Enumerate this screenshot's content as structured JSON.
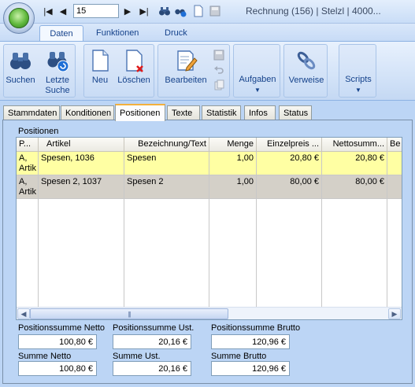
{
  "toolbar": {
    "record_number": "15",
    "window_title": "Rechnung    (156) | Stelzl | 4000..."
  },
  "ribbon_tabs": [
    {
      "label": "Daten",
      "active": true
    },
    {
      "label": "Funktionen",
      "active": false
    },
    {
      "label": "Druck",
      "active": false
    }
  ],
  "ribbon_buttons": {
    "suchen": "Suchen",
    "letzte_suche": "Letzte\nSuche",
    "neu": "Neu",
    "loeschen": "Löschen",
    "bearbeiten": "Bearbeiten",
    "aufgaben": "Aufgaben",
    "verweise": "Verweise",
    "scripts": "Scripts"
  },
  "doc_tabs": [
    {
      "label": "Stammdaten",
      "active": false
    },
    {
      "label": "Konditionen",
      "active": false
    },
    {
      "label": "Positionen",
      "active": true
    },
    {
      "label": "Texte",
      "active": false
    },
    {
      "label": "Statistik",
      "active": false
    },
    {
      "label": "Infos",
      "active": false
    },
    {
      "label": "Status",
      "active": false
    }
  ],
  "positions": {
    "section_label": "Positionen",
    "columns": [
      "P...",
      "Artikel",
      "Bezeichnung/Text",
      "Menge",
      "Einzelpreis ...",
      "Nettosumm...",
      "Be"
    ],
    "rows": [
      {
        "p": "A, Artik",
        "artikel": "Spesen, 1036",
        "bezeichnung": "Spesen",
        "menge": "1,00",
        "einzelpreis": "20,80 €",
        "nettosumme": "20,80 €",
        "be": ""
      },
      {
        "p": "A, Artik",
        "artikel": "Spesen 2, 1037",
        "bezeichnung": "Spesen 2",
        "menge": "1,00",
        "einzelpreis": "80,00 €",
        "nettosumme": "80,00 €",
        "be": ""
      }
    ]
  },
  "sums": {
    "positionssumme_netto_label": "Positionssumme Netto",
    "positionssumme_netto": "100,80 €",
    "positionssumme_ust_label": "Positionssumme Ust.",
    "positionssumme_ust": "20,16 €",
    "positionssumme_brutto_label": "Positionssumme Brutto",
    "positionssumme_brutto": "120,96 €",
    "summe_netto_label": "Summe Netto",
    "summe_netto": "100,80 €",
    "summe_ust_label": "Summe Ust.",
    "summe_ust": "20,16 €",
    "summe_brutto_label": "Summe Brutto",
    "summe_brutto": "120,96 €"
  }
}
